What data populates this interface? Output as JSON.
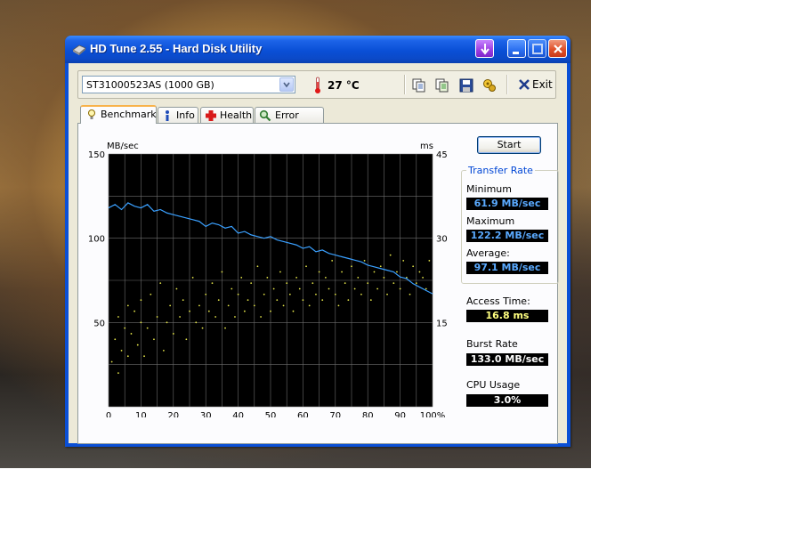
{
  "window": {
    "title": "HD Tune 2.55 - Hard Disk Utility"
  },
  "toolbar": {
    "drive": "ST31000523AS (1000 GB)",
    "temperature": "27 °C",
    "exit_label": "Exit"
  },
  "tabs": [
    {
      "label": "Benchmark",
      "active": true
    },
    {
      "label": "Info",
      "active": false
    },
    {
      "label": "Health",
      "active": false
    },
    {
      "label": "Error Scan",
      "active": false
    }
  ],
  "panel": {
    "start_label": "Start",
    "transfer_rate_title": "Transfer Rate",
    "minimum_label": "Minimum",
    "minimum_value": "61.9 MB/sec",
    "maximum_label": "Maximum",
    "maximum_value": "122.2 MB/sec",
    "average_label": "Average:",
    "average_value": "97.1 MB/sec",
    "access_time_label": "Access Time:",
    "access_time_value": "16.8 ms",
    "burst_rate_label": "Burst Rate",
    "burst_rate_value": "133.0 MB/sec",
    "cpu_usage_label": "CPU Usage",
    "cpu_usage_value": "3.0%"
  },
  "colors": {
    "transfer_line": "#3aa0ff",
    "access_dots": "#e6e64a",
    "chart_bg": "#000000",
    "grid": "#6c6c6c"
  },
  "chart_data": {
    "type": "line",
    "ylabel_left": "MB/sec",
    "ylabel_right": "ms",
    "x_ticks": [
      "0",
      "10",
      "20",
      "30",
      "40",
      "50",
      "60",
      "70",
      "80",
      "90",
      "100%"
    ],
    "y_left_ticks": [
      "150",
      "100",
      "50"
    ],
    "y_right_ticks": [
      "45",
      "30",
      "15"
    ],
    "xlim": [
      0,
      100
    ],
    "ylim_left": [
      0,
      150
    ],
    "ylim_right": [
      0,
      45
    ],
    "grid": true,
    "series": [
      {
        "name": "Transfer Rate",
        "axis": "left",
        "x": [
          0,
          2,
          4,
          6,
          8,
          10,
          12,
          14,
          16,
          18,
          20,
          22,
          24,
          26,
          28,
          30,
          32,
          34,
          36,
          38,
          40,
          42,
          44,
          46,
          48,
          50,
          52,
          54,
          56,
          58,
          60,
          62,
          64,
          66,
          68,
          70,
          72,
          74,
          76,
          78,
          80,
          82,
          84,
          86,
          88,
          90,
          92,
          94,
          96,
          98,
          100
        ],
        "y": [
          118,
          120,
          117,
          121,
          119,
          118,
          120,
          116,
          117,
          115,
          114,
          113,
          112,
          111,
          110,
          107,
          109,
          108,
          106,
          107,
          103,
          104,
          102,
          101,
          100,
          101,
          99,
          98,
          97,
          96,
          94,
          95,
          92,
          93,
          91,
          90,
          89,
          88,
          87,
          86,
          84,
          83,
          82,
          81,
          80,
          77,
          76,
          73,
          71,
          69,
          67
        ]
      },
      {
        "name": "Access Time",
        "axis": "right",
        "kind": "scatter",
        "x": [
          1,
          2,
          3,
          3,
          4,
          5,
          6,
          6,
          7,
          8,
          9,
          10,
          10,
          11,
          12,
          13,
          14,
          15,
          16,
          17,
          18,
          19,
          20,
          21,
          22,
          23,
          24,
          25,
          26,
          27,
          28,
          29,
          30,
          31,
          32,
          33,
          34,
          35,
          36,
          37,
          38,
          39,
          40,
          41,
          42,
          43,
          44,
          45,
          46,
          47,
          48,
          49,
          50,
          51,
          52,
          53,
          54,
          55,
          56,
          57,
          58,
          59,
          60,
          61,
          62,
          63,
          64,
          65,
          66,
          67,
          68,
          69,
          70,
          71,
          72,
          73,
          74,
          75,
          76,
          77,
          78,
          79,
          80,
          81,
          82,
          83,
          84,
          85,
          86,
          87,
          88,
          89,
          90,
          91,
          92,
          93,
          94,
          95,
          96,
          97,
          98,
          99
        ],
        "y": [
          8,
          12,
          16,
          6,
          10,
          14,
          18,
          9,
          13,
          17,
          11,
          15,
          19,
          9,
          14,
          20,
          12,
          16,
          22,
          10,
          15,
          18,
          13,
          21,
          16,
          19,
          12,
          17,
          23,
          15,
          18,
          14,
          20,
          17,
          22,
          16,
          19,
          24,
          14,
          18,
          21,
          16,
          20,
          23,
          17,
          19,
          22,
          18,
          25,
          16,
          20,
          23,
          17,
          21,
          19,
          24,
          18,
          22,
          20,
          17,
          23,
          21,
          19,
          25,
          18,
          22,
          20,
          24,
          19,
          23,
          21,
          26,
          20,
          18,
          24,
          22,
          19,
          25,
          21,
          23,
          20,
          26,
          22,
          19,
          24,
          21,
          25,
          23,
          20,
          27,
          22,
          24,
          21,
          26,
          23,
          20,
          25,
          22,
          24,
          23,
          21,
          26
        ]
      }
    ]
  }
}
